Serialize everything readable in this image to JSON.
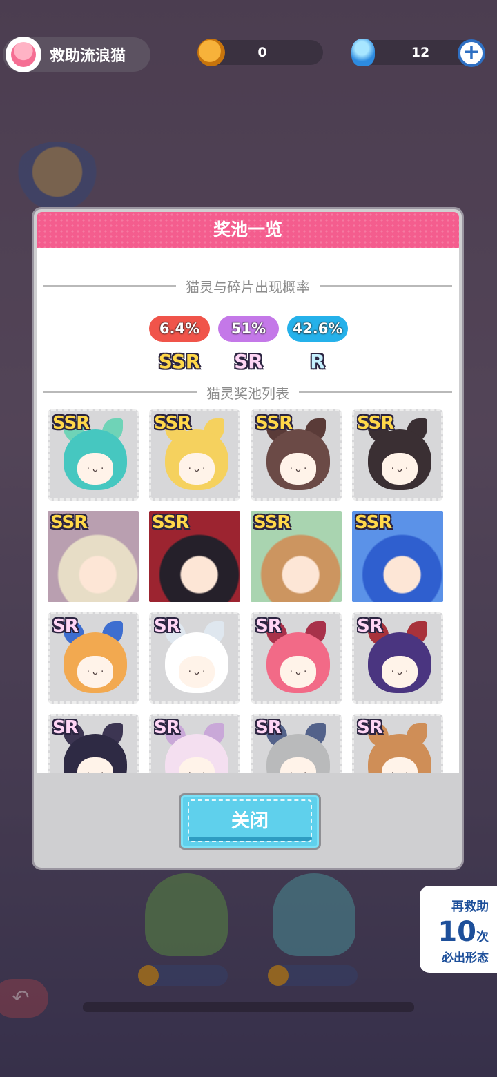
{
  "header": {
    "title": "救助流浪猫",
    "coins": "0",
    "gems": "12",
    "add_icon": "plus-icon"
  },
  "dialog": {
    "title": "奖池一览",
    "rates_title": "猫灵与碎片出现概率",
    "rates": [
      {
        "rank": "SSR",
        "value": "6.4%",
        "color": "#f0544a"
      },
      {
        "rank": "SR",
        "value": "51%",
        "color": "#c478e8"
      },
      {
        "rank": "R",
        "value": "42.6%",
        "color": "#25b1ea"
      }
    ],
    "pool_title": "猫灵奖池列表",
    "pool": [
      {
        "rank": "SSR",
        "style": "chibi",
        "hair": "#46c7c0",
        "ear": "#6fd3b7"
      },
      {
        "rank": "SSR",
        "style": "chibi",
        "hair": "#f5d15e",
        "ear": "#f5d15e"
      },
      {
        "rank": "SSR",
        "style": "chibi",
        "hair": "#6b4a46",
        "ear": "#5a3b38"
      },
      {
        "rank": "SSR",
        "style": "chibi",
        "hair": "#3a2f33",
        "ear": "#3a2f33"
      },
      {
        "rank": "SSR",
        "style": "photo",
        "hair": "#e7ddc6",
        "bg": "#b99fb0"
      },
      {
        "rank": "SSR",
        "style": "photo",
        "hair": "#25202a",
        "bg": "#9c2430"
      },
      {
        "rank": "SSR",
        "style": "photo",
        "hair": "#cc9560",
        "bg": "#a9d4b0"
      },
      {
        "rank": "SSR",
        "style": "photo",
        "hair": "#2f5fcf",
        "bg": "#5b92e8"
      },
      {
        "rank": "SR",
        "style": "chibi",
        "hair": "#f2a950",
        "ear": "#3e6ed0"
      },
      {
        "rank": "SR",
        "style": "chibi",
        "hair": "#ffffff",
        "ear": "#dfe7ef"
      },
      {
        "rank": "SR",
        "style": "chibi",
        "hair": "#f26a87",
        "ear": "#a8314a"
      },
      {
        "rank": "SR",
        "style": "chibi",
        "hair": "#4a3580",
        "ear": "#a8323b"
      },
      {
        "rank": "SR",
        "style": "chibi",
        "hair": "#2e2a44",
        "ear": "#3c3552"
      },
      {
        "rank": "SR",
        "style": "chibi",
        "hair": "#f4dff0",
        "ear": "#c9a8d8"
      },
      {
        "rank": "SR",
        "style": "chibi",
        "hair": "#b9babb",
        "ear": "#53628a"
      },
      {
        "rank": "SR",
        "style": "chibi",
        "hair": "#cf8e57",
        "ear": "#cf8e57"
      }
    ],
    "close_label": "关闭"
  },
  "promo": {
    "line1": "再救助",
    "count": "10",
    "unit": "次",
    "line3": "必出形态"
  },
  "background": {
    "back_icon": "back-arrow-icon"
  }
}
